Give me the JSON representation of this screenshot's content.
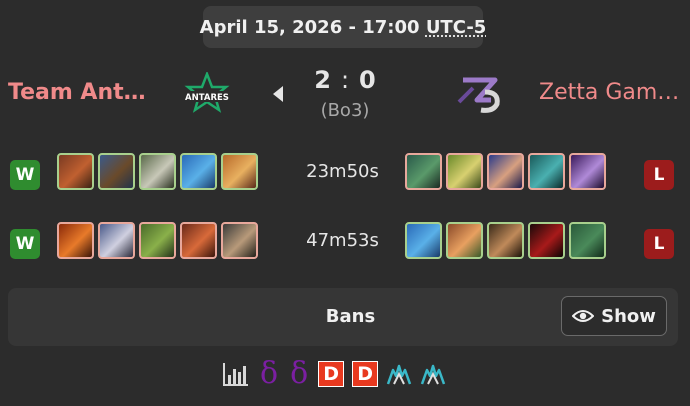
{
  "match": {
    "date": "April 15, 2026 - 17:00",
    "timezone": "UTC-5",
    "score_left": "2",
    "score_sep": ":",
    "score_right": "0",
    "format": "(Bo3)"
  },
  "teams": {
    "left": {
      "name": "Team Antares",
      "logo_text": "ANTARES"
    },
    "right": {
      "name": "Zetta Gaming"
    }
  },
  "games": [
    {
      "result_left": "W",
      "result_right": "L",
      "duration": "23m50s",
      "left_heroes": [
        "hero-1",
        "hero-2",
        "hero-3",
        "hero-4",
        "hero-5"
      ],
      "right_heroes": [
        "hero-1",
        "hero-2",
        "hero-3",
        "hero-4",
        "hero-5"
      ]
    },
    {
      "result_left": "W",
      "result_right": "L",
      "duration": "47m53s",
      "left_heroes": [
        "hero-1",
        "hero-2",
        "hero-3",
        "hero-4",
        "hero-5"
      ],
      "right_heroes": [
        "hero-1",
        "hero-2",
        "hero-3",
        "hero-4",
        "hero-5"
      ]
    }
  ],
  "bans": {
    "title": "Bans",
    "show_label": "Show"
  },
  "links": {
    "icons": [
      "stats-icon",
      "datdota-icon",
      "datdota-icon",
      "dotabuff-icon",
      "dotabuff-icon",
      "stratz-icon",
      "stratz-icon"
    ],
    "d_label": "D"
  },
  "colors": {
    "win": "#2f8c2f",
    "loss": "#9c1c1c",
    "team_name": "#f08a8a",
    "radiant_border": "#a8d08d",
    "dire_border": "#e8a89c"
  }
}
